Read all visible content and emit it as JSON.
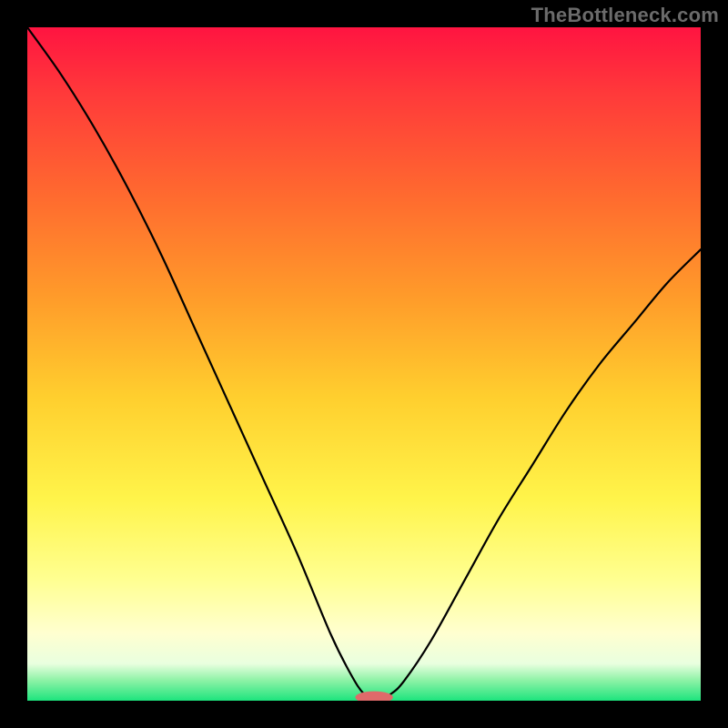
{
  "watermark": "TheBottleneck.com",
  "chart_data": {
    "type": "line",
    "title": "",
    "xlabel": "",
    "ylabel": "",
    "xlim": [
      0,
      100
    ],
    "ylim": [
      0,
      100
    ],
    "series": [
      {
        "name": "bottleneck-curve",
        "x": [
          0,
          5,
          10,
          15,
          20,
          25,
          30,
          35,
          40,
          45,
          48,
          50,
          52,
          54,
          56,
          60,
          65,
          70,
          75,
          80,
          85,
          90,
          95,
          100
        ],
        "y": [
          100,
          93,
          85,
          76,
          66,
          55,
          44,
          33,
          22,
          10,
          4,
          1,
          0,
          1,
          3,
          9,
          18,
          27,
          35,
          43,
          50,
          56,
          62,
          67
        ]
      }
    ],
    "marker": {
      "name": "optimal-marker",
      "x": 51.5,
      "y": 0.5,
      "rx": 2.8,
      "ry": 0.9,
      "color": "#e06a6a"
    },
    "background": {
      "type": "vertical-gradient",
      "stops": [
        {
          "offset": 0.0,
          "color": "#ff1441"
        },
        {
          "offset": 0.1,
          "color": "#ff3a3a"
        },
        {
          "offset": 0.25,
          "color": "#ff6a2f"
        },
        {
          "offset": 0.4,
          "color": "#ff9b2a"
        },
        {
          "offset": 0.55,
          "color": "#ffcf2e"
        },
        {
          "offset": 0.7,
          "color": "#fff44a"
        },
        {
          "offset": 0.82,
          "color": "#ffff91"
        },
        {
          "offset": 0.9,
          "color": "#ffffd0"
        },
        {
          "offset": 0.945,
          "color": "#e9ffdf"
        },
        {
          "offset": 0.97,
          "color": "#8df2a6"
        },
        {
          "offset": 1.0,
          "color": "#1de47d"
        }
      ]
    }
  }
}
